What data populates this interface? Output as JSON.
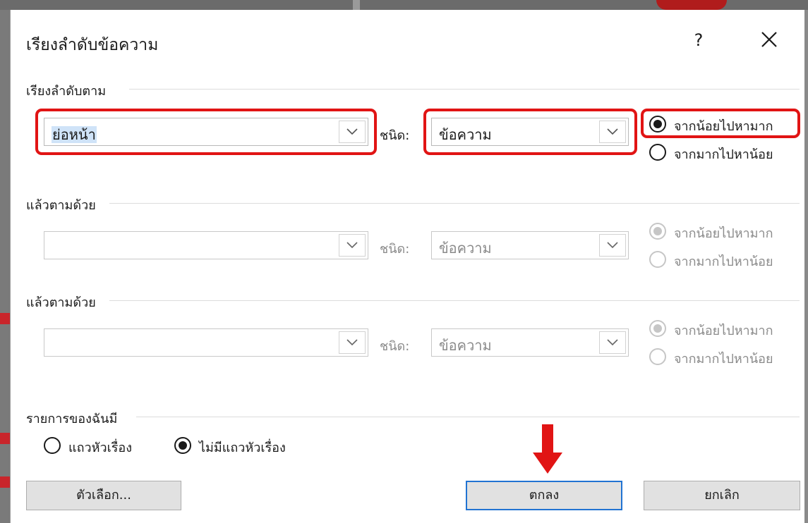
{
  "dialog": {
    "title": "เรียงลำดับข้อความ",
    "help_label": "?",
    "close_icon": "close-icon"
  },
  "sort_by": {
    "label": "เรียงลำดับตาม",
    "field_value": "ย่อหน้า",
    "type_label": "ชนิด:",
    "type_value": "ข้อความ",
    "ascending_label": "จากน้อยไปหามาก",
    "descending_label": "จากมากไปหาน้อย",
    "selected": "ascending"
  },
  "then_by_1": {
    "label": "แล้วตามด้วย",
    "field_value": "",
    "type_label": "ชนิด:",
    "type_value": "ข้อความ",
    "ascending_label": "จากน้อยไปหามาก",
    "descending_label": "จากมากไปหาน้อย",
    "enabled": false
  },
  "then_by_2": {
    "label": "แล้วตามด้วย",
    "field_value": "",
    "type_label": "ชนิด:",
    "type_value": "ข้อความ",
    "ascending_label": "จากน้อยไปหามาก",
    "descending_label": "จากมากไปหาน้อย",
    "enabled": false
  },
  "my_list_has": {
    "label": "รายการของฉันมี",
    "header_row_label": "แถวหัวเรื่อง",
    "no_header_row_label": "ไม่มีแถวหัวเรื่อง",
    "selected": "no_header_row"
  },
  "buttons": {
    "options_label": "ตัวเลือก...",
    "ok_label": "ตกลง",
    "cancel_label": "ยกเลิก"
  },
  "colors": {
    "highlight": "#e11414",
    "default_button_border": "#2173d2",
    "selection": "#cfe3f8"
  }
}
